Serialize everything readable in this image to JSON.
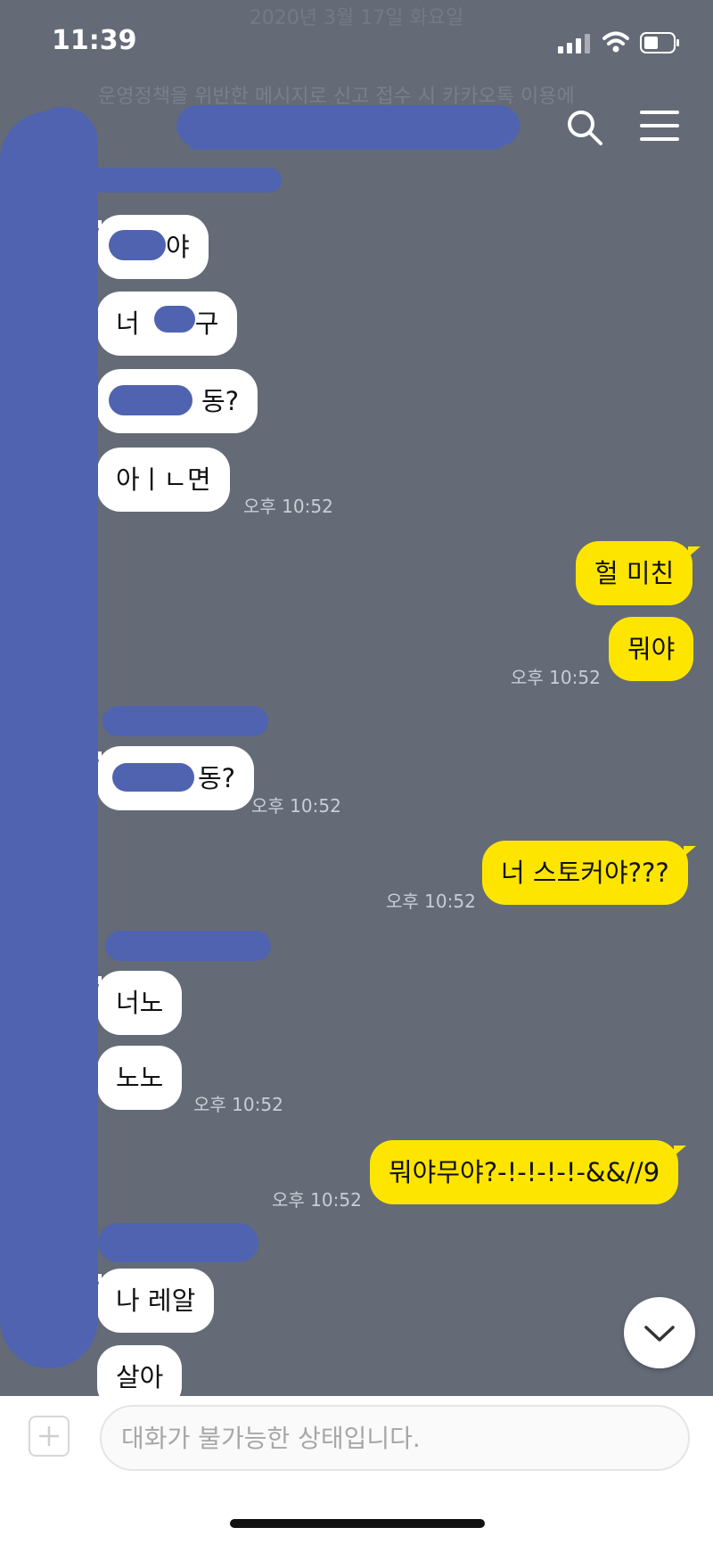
{
  "status_bar": {
    "time": "11:39"
  },
  "header": {
    "faded_date": "2020년 3월 17일 화요일",
    "faded_notice": "운영정책을 위반한 메시지로 신고 접수 시 카카오톡 이용에"
  },
  "messages": {
    "m1": "야",
    "m2": "너",
    "m2b": "구",
    "m3": "동?",
    "m4": "아ㅣㄴ면",
    "t1": "오후 10:52",
    "m5": "헐 미친",
    "m6": "뭐야",
    "t2": "오후 10:52",
    "m7": "동?",
    "t3": "오후 10:52",
    "m8": "너 스토커야???",
    "t4": "오후 10:52",
    "m9": "너노",
    "m10": "노노",
    "t5": "오후 10:52",
    "m11": "뭐야무야?-!-!-!-!-&&//9",
    "t6": "오후 10:52",
    "m12": "나 레알",
    "m13": "살아"
  },
  "input": {
    "placeholder": "대화가 불가능한 상태입니다."
  },
  "colors": {
    "background": "#646b77",
    "my_bubble": "#fee500",
    "other_bubble": "#ffffff",
    "redaction": "#4f63b0"
  },
  "icons": [
    "signal-icon",
    "wifi-icon",
    "battery-icon",
    "search-icon",
    "menu-icon",
    "chevron-down-icon",
    "plus-icon"
  ]
}
